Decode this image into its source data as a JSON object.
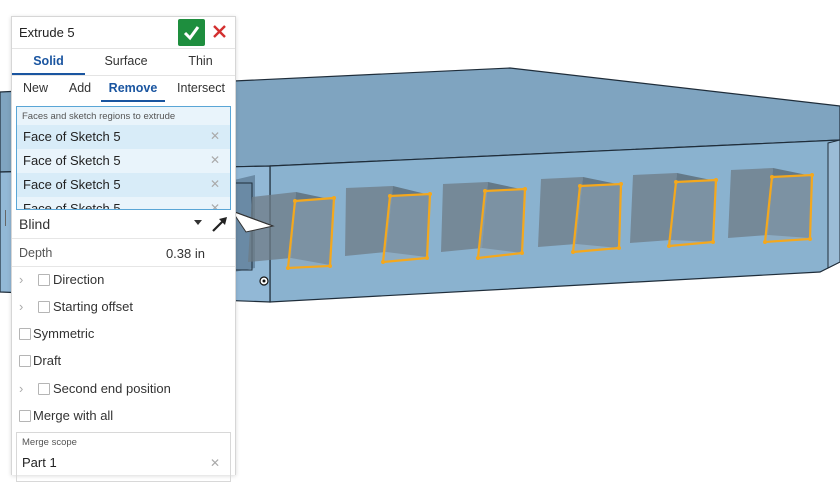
{
  "dialog": {
    "title": "Extrude 5",
    "confirm_icon": "check-icon",
    "cancel_icon": "close-icon",
    "accent_color": "#1a55a0",
    "confirm_color": "#1e8e3e",
    "cancel_color": "#d32f2f"
  },
  "type_tabs": [
    {
      "label": "Solid",
      "active": true
    },
    {
      "label": "Surface",
      "active": false
    },
    {
      "label": "Thin",
      "active": false
    }
  ],
  "op_tabs": [
    {
      "label": "New",
      "active": false
    },
    {
      "label": "Add",
      "active": false
    },
    {
      "label": "Remove",
      "active": true
    },
    {
      "label": "Intersect",
      "active": false
    }
  ],
  "faces": {
    "label": "Faces and sketch regions to extrude",
    "items": [
      "Face of Sketch 5",
      "Face of Sketch 5",
      "Face of Sketch 5",
      "Face of Sketch 5"
    ]
  },
  "end_type": {
    "selected": "Blind"
  },
  "depth": {
    "label": "Depth",
    "value": "0.38 in"
  },
  "options": {
    "direction": "Direction",
    "starting_offset": "Starting offset",
    "symmetric": "Symmetric",
    "draft": "Draft",
    "second_end_position": "Second end position",
    "merge_with_all": "Merge with all"
  },
  "merge_scope": {
    "label": "Merge scope",
    "value": "Part 1"
  }
}
